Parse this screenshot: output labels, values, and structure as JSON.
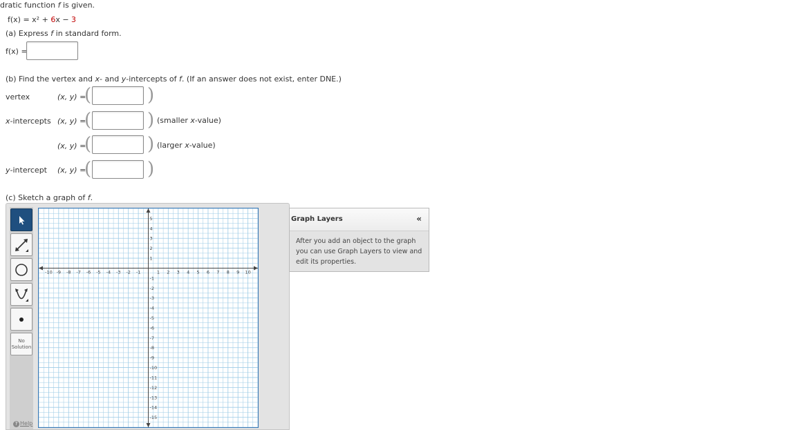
{
  "intro": {
    "text": "dratic function ",
    "f": "f",
    "suffix": " is given."
  },
  "function": {
    "lhs": "f(x) = x² + ",
    "coef": "6",
    "mid": "x − ",
    "const": "3"
  },
  "part_a": {
    "prefix": "(a) Express ",
    "f": "f",
    "suffix": " in standard form.",
    "answer_label": "f(x) =",
    "answer_value": ""
  },
  "part_b": {
    "prompt_prefix": "(b) Find the vertex and ",
    "x": "x",
    "dash_and": "- and ",
    "y": "y",
    "prompt_mid": "-intercepts of ",
    "f": "f",
    "prompt_suffix": ". (If an answer does not exist, enter DNE.)",
    "xy_label": "(x, y) =",
    "vertex_label": "vertex",
    "x_intercepts_label_x": "x",
    "x_intercepts_label_rest": "-intercepts",
    "y_intercept_label_y": "y",
    "y_intercept_label_rest": "-intercept",
    "smaller_note_open": "(smaller ",
    "smaller_x": "x",
    "smaller_note_close": "-value)",
    "larger_note_open": "(larger ",
    "larger_x": "x",
    "larger_note_close": "-value)"
  },
  "part_c": {
    "prefix": "(c) Sketch a graph of ",
    "f": "f",
    "suffix": "."
  },
  "graph": {
    "x_range": [
      -11,
      11
    ],
    "y_range": [
      -16,
      6
    ],
    "x_ticks": [
      -10,
      -9,
      -8,
      -7,
      -6,
      -5,
      -4,
      -3,
      -2,
      -1,
      1,
      2,
      3,
      4,
      5,
      6,
      7,
      8,
      9,
      10
    ],
    "y_ticks": [
      5,
      4,
      3,
      2,
      1,
      -1,
      -2,
      -3,
      -4,
      -5,
      -6,
      -7,
      -8,
      -9,
      -10,
      -11,
      -12,
      -13,
      -14,
      -15
    ],
    "grid_color": "#9ecbe6",
    "axis_color": "#444444"
  },
  "tools": {
    "no_solution_line1": "No",
    "no_solution_line2": "Solution",
    "help": "Help"
  },
  "layers": {
    "title": "Graph Layers",
    "collapse": "«",
    "text": "After you add an object to the graph you can use Graph Layers to view and edit its properties."
  }
}
